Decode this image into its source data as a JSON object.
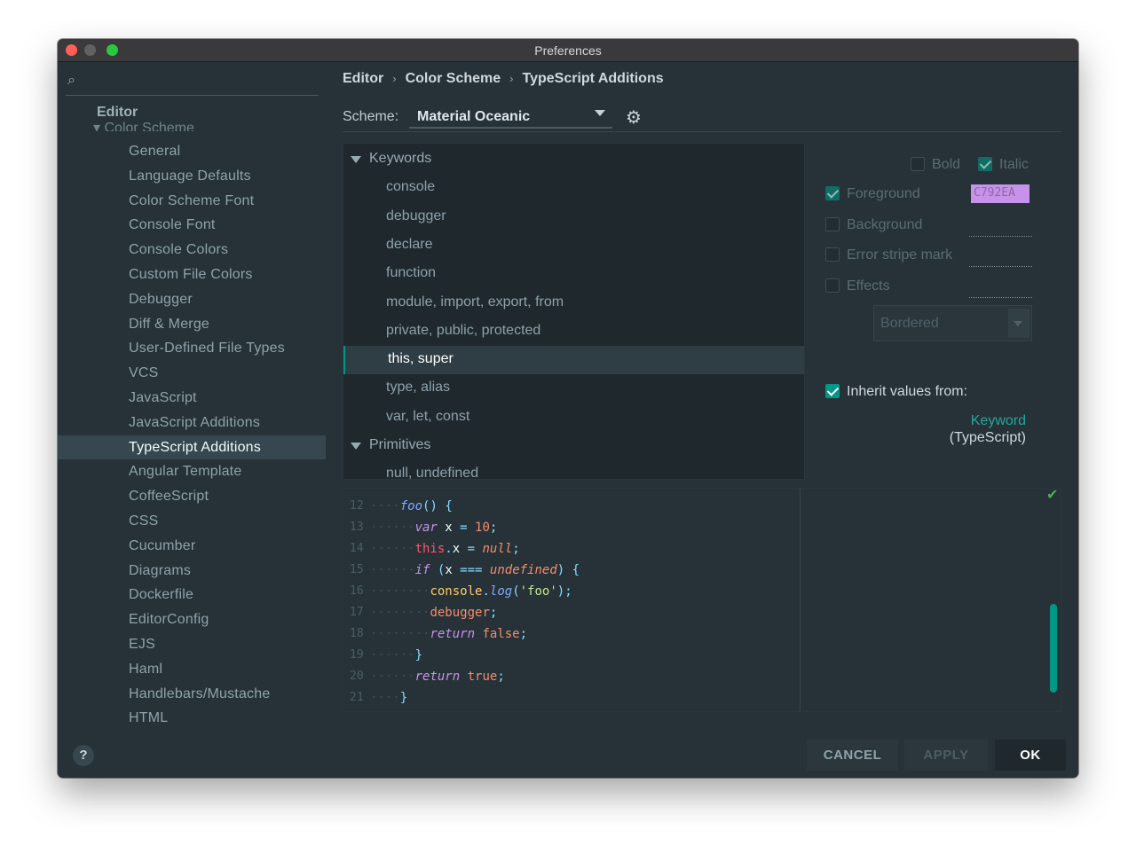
{
  "window": {
    "title": "Preferences"
  },
  "sidebar": {
    "search_placeholder": "",
    "header": "Editor",
    "subheader": "Color Scheme",
    "items": [
      "General",
      "Language Defaults",
      "Color Scheme Font",
      "Console Font",
      "Console Colors",
      "Custom File Colors",
      "Debugger",
      "Diff & Merge",
      "User-Defined File Types",
      "VCS",
      "JavaScript",
      "JavaScript Additions",
      "TypeScript Additions",
      "Angular Template",
      "CoffeeScript",
      "CSS",
      "Cucumber",
      "Diagrams",
      "Dockerfile",
      "EditorConfig",
      "EJS",
      "Haml",
      "Handlebars/Mustache",
      "HTML"
    ],
    "selected": "TypeScript Additions"
  },
  "breadcrumb": [
    "Editor",
    "Color Scheme",
    "TypeScript Additions"
  ],
  "scheme": {
    "label": "Scheme:",
    "value": "Material Oceanic"
  },
  "tree": {
    "groups": [
      {
        "label": "Keywords",
        "items": [
          "console",
          "debugger",
          "declare",
          "function",
          "module, import, export, from",
          "private, public, protected",
          "this, super",
          "type, alias",
          "var, let, const"
        ]
      },
      {
        "label": "Primitives",
        "items": [
          "null, undefined"
        ]
      }
    ],
    "selected": "this, super"
  },
  "attributes": {
    "bold": "Bold",
    "italic": "Italic",
    "foreground": "Foreground",
    "foreground_color": "C792EA",
    "background": "Background",
    "error_stripe": "Error stripe mark",
    "effects": "Effects",
    "effects_type": "Bordered",
    "inherit": "Inherit values from:",
    "inherit_link": "Keyword",
    "inherit_sub": "(TypeScript)",
    "accent_color": "#009688"
  },
  "preview": {
    "line_numbers": [
      "12",
      "13",
      "14",
      "15",
      "16",
      "17",
      "18",
      "19",
      "20",
      "21"
    ]
  },
  "buttons": {
    "cancel": "CANCEL",
    "apply": "APPLY",
    "ok": "OK",
    "help": "?"
  }
}
